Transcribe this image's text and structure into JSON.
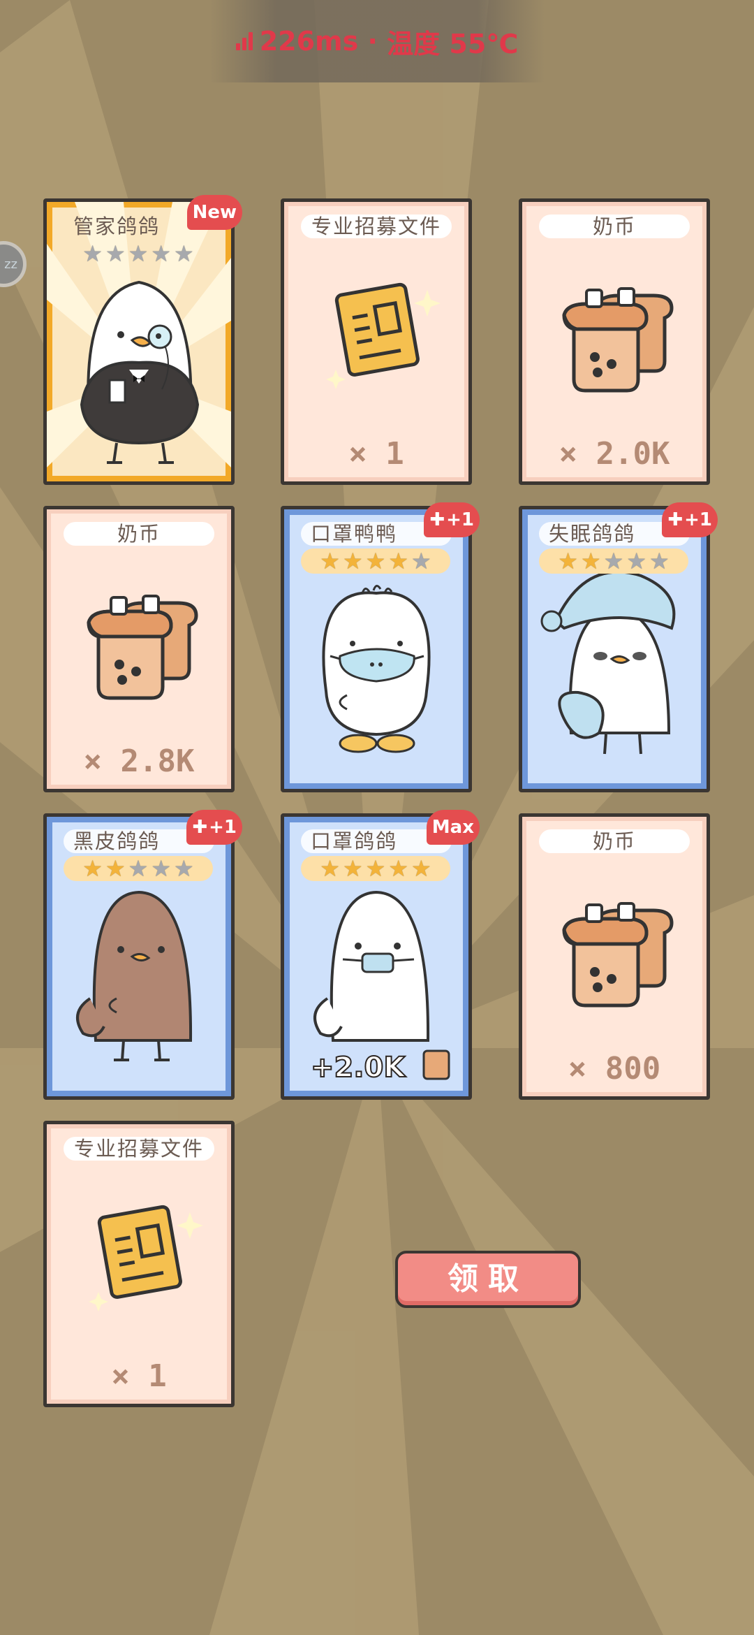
{
  "status_bar": {
    "ping": "226ms",
    "separator": " · ",
    "temperature": "温度 55℃"
  },
  "float_button": {
    "label": "zz"
  },
  "cards": [
    {
      "name": "管家鸽鸽",
      "type": "character",
      "frame": "gold",
      "stars_filled": 0,
      "stars_total": 5,
      "badge": "New"
    },
    {
      "name": "专业招募文件",
      "type": "item",
      "icon": "document-icon",
      "quantity": "× 1"
    },
    {
      "name": "奶币",
      "type": "item",
      "icon": "milk-tea-coin-icon",
      "quantity": "× 2.0K"
    },
    {
      "name": "奶币",
      "type": "item",
      "icon": "milk-tea-coin-icon",
      "quantity": "× 2.8K"
    },
    {
      "name": "口罩鸭鸭",
      "type": "character",
      "frame": "blue",
      "stars_filled": 4,
      "stars_total": 5,
      "badge": "+1"
    },
    {
      "name": "失眠鸽鸽",
      "type": "character",
      "frame": "blue",
      "stars_filled": 2,
      "stars_total": 5,
      "badge": "+1"
    },
    {
      "name": "黑皮鸽鸽",
      "type": "character",
      "frame": "blue",
      "stars_filled": 2,
      "stars_total": 5,
      "badge": "+1"
    },
    {
      "name": "口罩鸽鸽",
      "type": "character",
      "frame": "blue",
      "stars_filled": 5,
      "stars_total": 5,
      "badge": "Max",
      "bonus": "+2.0K"
    },
    {
      "name": "奶币",
      "type": "item",
      "icon": "milk-tea-coin-icon",
      "quantity": "× 800"
    },
    {
      "name": "专业招募文件",
      "type": "item",
      "icon": "document-icon",
      "quantity": "× 1"
    }
  ],
  "claim_button": {
    "label": "领取"
  },
  "colors": {
    "badge": "#e44d4f",
    "claim": "#f28c86",
    "star": "#f3b33a",
    "status": "#e0394a"
  }
}
